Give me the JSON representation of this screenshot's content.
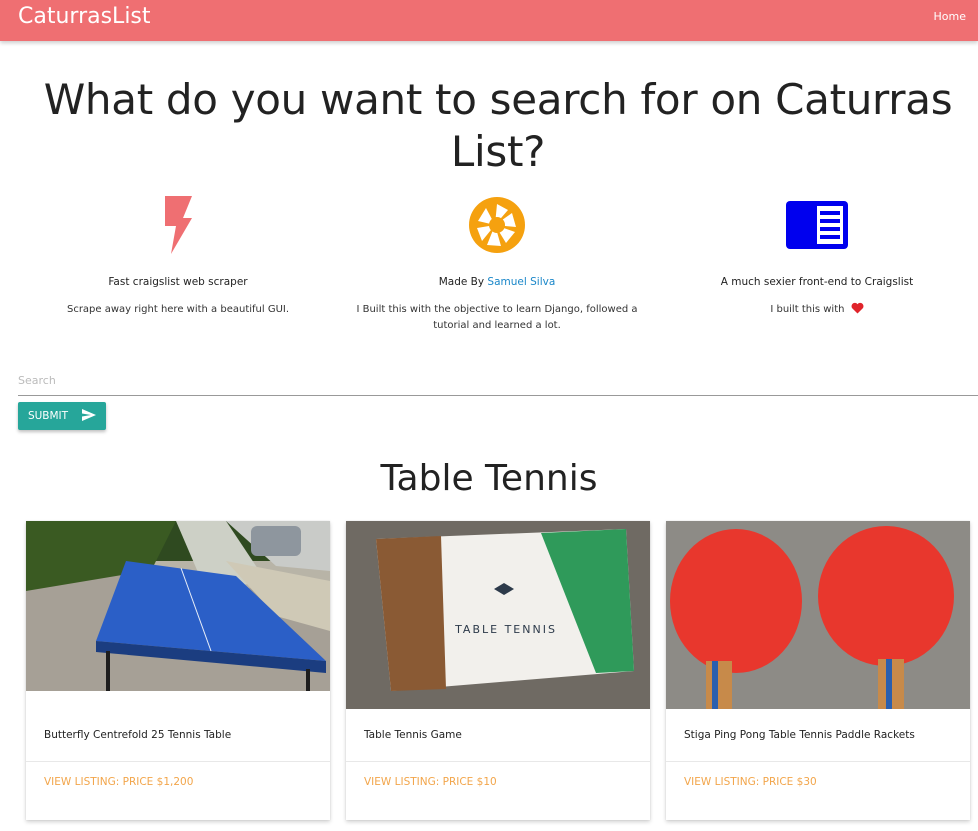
{
  "navbar": {
    "brand": "CaturrasList",
    "home_label": "Home",
    "color": "#ef6f72"
  },
  "hero": {
    "title": "What do you want to search for on Caturras List?"
  },
  "features": [
    {
      "icon": "bolt-icon",
      "icon_color": "#ef6f72",
      "title": "Fast craigslist web scraper",
      "description": "Scrape away right here with a beautiful GUI."
    },
    {
      "icon": "camera-aperture-icon",
      "icon_color": "#f5a10f",
      "title_prefix": "Made By ",
      "title_link": "Samuel Silva",
      "description": "I Built this with the objective to learn Django, followed a tutorial and learned a lot."
    },
    {
      "icon": "chrome-reader-mode-icon",
      "icon_color": "#0000ee",
      "title": "A much sexier front-end to Craigslist",
      "description": "I built this with"
    }
  ],
  "search": {
    "placeholder": "Search",
    "value": "",
    "submit_label": "SUBMIT",
    "submit_color": "#26a69a"
  },
  "results": {
    "heading": "Table Tennis",
    "link_color": "#f2a54a",
    "items": [
      {
        "title": "Butterfly Centrefold 25 Tennis Table",
        "link": "VIEW LISTING: PRICE $1,200"
      },
      {
        "title": "Table Tennis Game",
        "link": "VIEW LISTING: PRICE $10"
      },
      {
        "title": "Stiga Ping Pong Table Tennis Paddle Rackets",
        "link": "VIEW LISTING: PRICE $30"
      }
    ],
    "product_box_text": "TABLE TENNIS"
  }
}
